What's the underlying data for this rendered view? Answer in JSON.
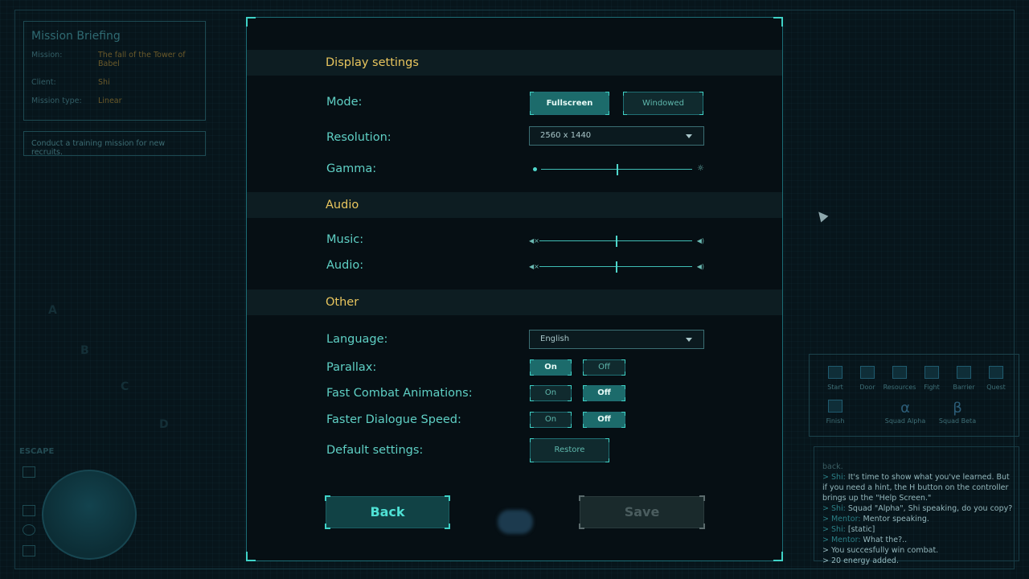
{
  "background": {
    "briefing": {
      "title": "Mission Briefing",
      "rows": [
        {
          "label": "Mission:",
          "value": "The fall of the Tower of Babel"
        },
        {
          "label": "Client:",
          "value": "Shi"
        },
        {
          "label": "Mission type:",
          "value": "Linear"
        }
      ],
      "description": "Conduct a training mission for new recruits."
    },
    "escape_label": "ESCAPE",
    "quest_bar": [
      {
        "label": "Start",
        "icon": "start-icon"
      },
      {
        "label": "Door",
        "icon": "door-icon"
      },
      {
        "label": "Resources",
        "icon": "resources-icon"
      },
      {
        "label": "Fight",
        "icon": "fight-icon"
      },
      {
        "label": "Barrier",
        "icon": "barrier-icon"
      },
      {
        "label": "Quest",
        "icon": "quest-icon"
      }
    ],
    "quest_bar_row2": [
      {
        "label": "Finish",
        "icon": "finish-icon"
      }
    ],
    "squads": [
      {
        "symbol": "α",
        "label": "Squad Alpha"
      },
      {
        "symbol": "β",
        "label": "Squad Beta"
      }
    ],
    "log": [
      {
        "speaker": "",
        "text": "back.",
        "dim": true
      },
      {
        "speaker": "> Shi:",
        "text": " It's time to show what you've learned. But"
      },
      {
        "speaker": "",
        "text": "if you need a hint, the H button on the controller"
      },
      {
        "speaker": "",
        "text": "brings up the \"Help Screen.\""
      },
      {
        "speaker": "> Shi:",
        "text": " Squad \"Alpha\", Shi speaking, do you copy?"
      },
      {
        "speaker": "> Mentor:",
        "text": " Mentor speaking."
      },
      {
        "speaker": "> Shi:",
        "text": " [static]"
      },
      {
        "speaker": "> Mentor:",
        "text": " What the?.."
      },
      {
        "speaker": "",
        "text": "> You succesfully win combat."
      },
      {
        "speaker": "",
        "text": "> 20 energy added."
      }
    ]
  },
  "settings": {
    "display": {
      "header": "Display settings",
      "mode_label": "Mode:",
      "mode_options": [
        "Fullscreen",
        "Windowed"
      ],
      "mode_selected": "Fullscreen",
      "resolution_label": "Resolution:",
      "resolution_value": "2560 x 1440",
      "gamma_label": "Gamma:",
      "gamma_level": 0.5
    },
    "audio": {
      "header": "Audio",
      "music_label": "Music:",
      "music_level": 0.5,
      "audio_label": "Audio:",
      "audio_level": 0.5
    },
    "other": {
      "header": "Other",
      "language_label": "Language:",
      "language_value": "English",
      "toggles": [
        {
          "label": "Parallax:",
          "value": "On"
        },
        {
          "label": "Fast Combat Animations:",
          "value": "Off"
        },
        {
          "label": "Faster Dialogue Speed:",
          "value": "Off"
        }
      ],
      "on_label": "On",
      "off_label": "Off",
      "default_label": "Default settings:",
      "restore_label": "Restore"
    },
    "back_label": "Back",
    "save_label": "Save"
  }
}
